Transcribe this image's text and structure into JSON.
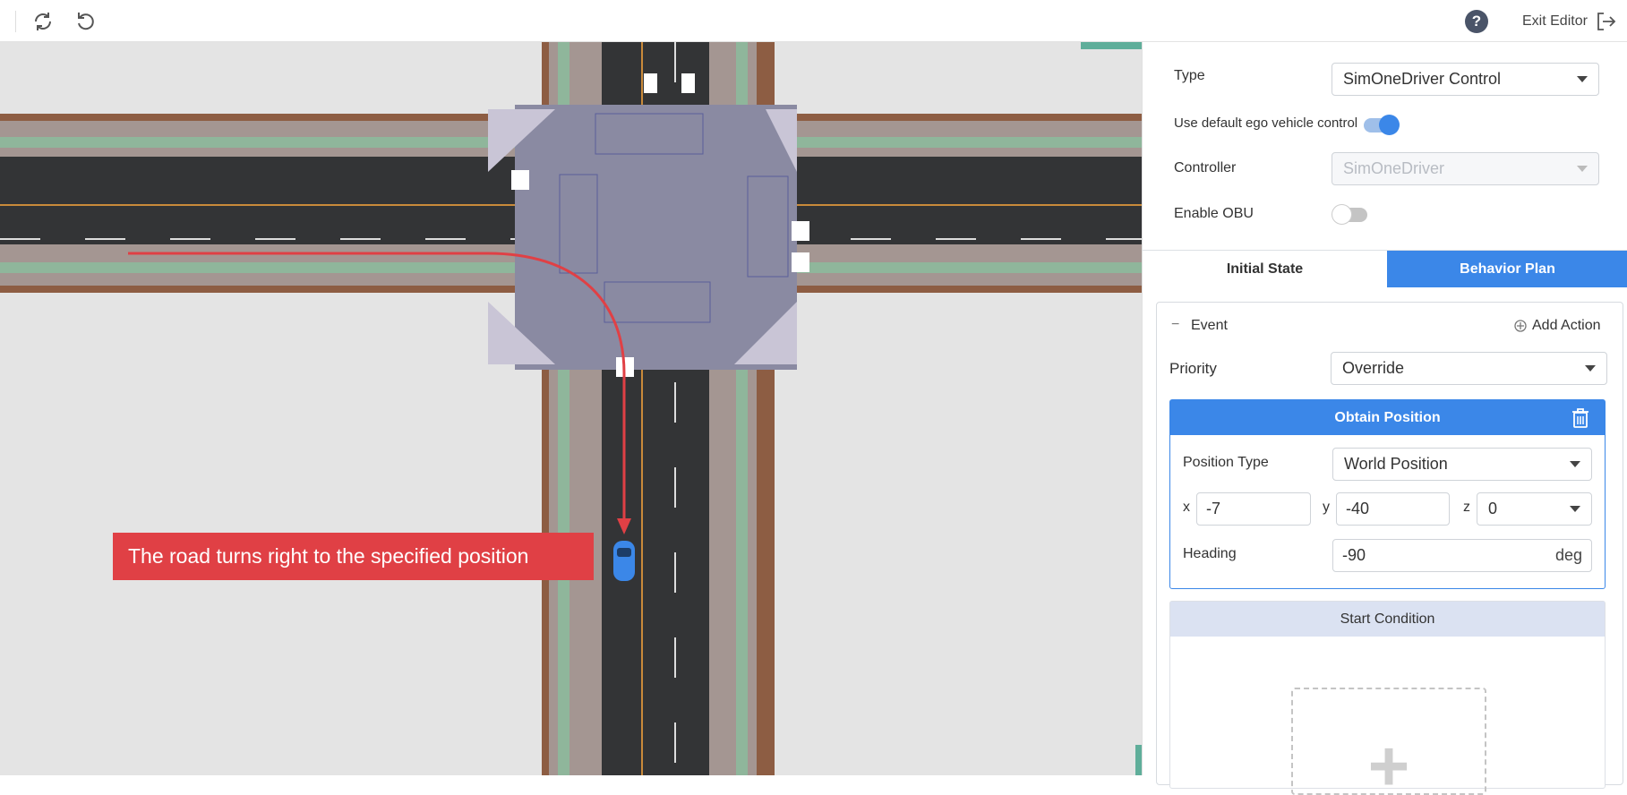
{
  "toolbar": {
    "redo_icon": "redo-icon",
    "undo_icon": "undo-icon",
    "help_label": "?",
    "exit_label": "Exit Editor"
  },
  "map": {
    "annotation": "The road turns right to the specified position",
    "route_color": "#e04045",
    "vehicle_color": "#3b87e8"
  },
  "panel": {
    "type_label": "Type",
    "type_value": "SimOneDriver Control",
    "default_ego_label": "Use default ego vehicle control",
    "default_ego_on": true,
    "controller_label": "Controller",
    "controller_value": "SimOneDriver",
    "obu_label": "Enable OBU",
    "obu_on": false,
    "tabs": [
      {
        "label": "Initial State",
        "active": false
      },
      {
        "label": "Behavior Plan",
        "active": true
      }
    ],
    "event": {
      "collapse_symbol": "−",
      "title": "Event",
      "add_action_label": "Add Action",
      "priority_label": "Priority",
      "priority_value": "Override",
      "action": {
        "title": "Obtain Position",
        "position_type_label": "Position Type",
        "position_type_value": "World Position",
        "x_label": "x",
        "x_value": "-7",
        "y_label": "y",
        "y_value": "-40",
        "z_label": "z",
        "z_value": "0",
        "heading_label": "Heading",
        "heading_value": "-90",
        "heading_unit": "deg"
      },
      "start_condition_label": "Start Condition",
      "add_condition_symbol": "+"
    }
  },
  "colors": {
    "accent": "#3b87e8",
    "annotation": "#e04045"
  }
}
